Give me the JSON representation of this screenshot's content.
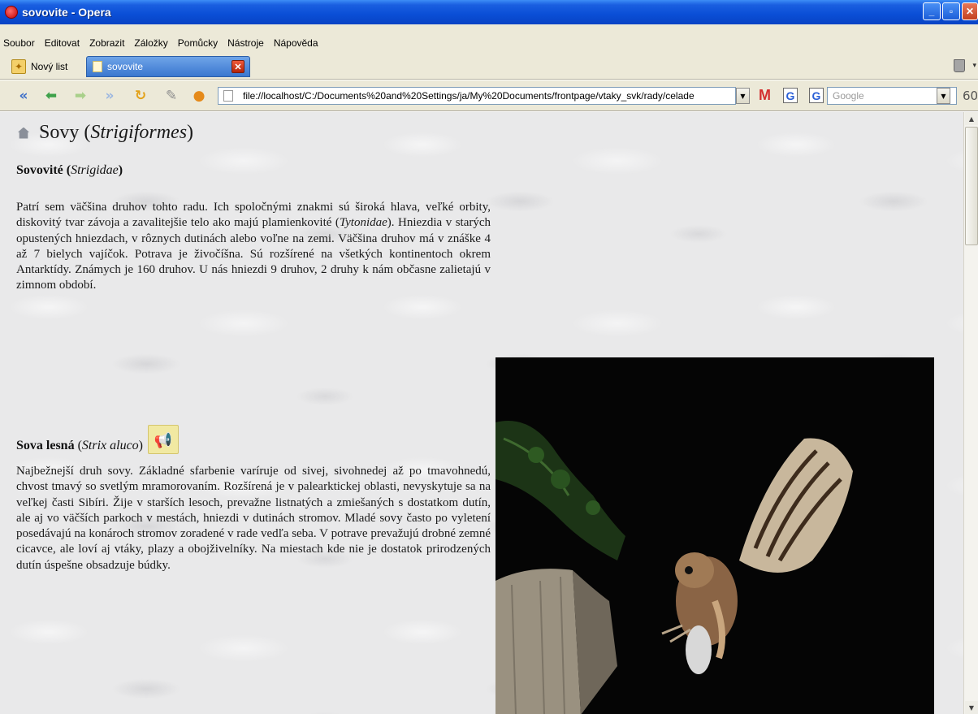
{
  "window": {
    "title": "sovovite - Opera",
    "minimize_label": "_",
    "maximize_label": "▫",
    "close_label": "✕"
  },
  "menu": {
    "items": [
      "Soubor",
      "Editovat",
      "Zobrazit",
      "Záložky",
      "Pomůcky",
      "Nástroje",
      "Nápověda"
    ]
  },
  "tabs": {
    "new_tab_label": "Nový list",
    "active_tab_label": "sovovite",
    "close_label": "✕"
  },
  "toolbar": {
    "address": "file://localhost/C:/Documents%20and%20Settings/ja/My%20Documents/frontpage/vtaky_svk/rady/celade",
    "search_placeholder": "Google",
    "gmail_glyph": "M",
    "g_glyph": "G"
  },
  "page": {
    "order_name": "Sovy",
    "order_latin": "Strigiformes",
    "family_name": "Sovovité",
    "family_latin": "Strigidae",
    "family_text_1": "Patrí sem väčšina druhov tohto radu. Ich spoločnými znakmi sú široká hlava, veľké orbity, diskovitý tvar závoja a zavalitejšie telo ako majú plamienkovité (",
    "family_text_latin": "Tytonidae",
    "family_text_2": "). Hniezdia v starých opustených hniezdach, v rôznych dutinách alebo voľne na zemi. Väčšina druhov má v znáške 4 až 7 bielych vajíčok. Potrava je živočíšna. Sú rozšírené na všetkých kontinentoch okrem Antarktídy. Známych je 160 druhov. U nás hniezdi 9 druhov, 2 druhy k nám občasne zalietajú v zimnom období.",
    "species_name": "Sova lesná",
    "species_latin": "Strix aluco",
    "species_text": "Najbežnejší druh sovy. Základné sfarbenie varíruje od sivej, sivohnedej až po tmavohnedú, chvost tmavý so svetlým mramorovaním. Rozšírená je v palearktickej oblasti, nevyskytuje sa na veľkej časti Sibíri. Žije v starších lesoch, prevažne listnatých a zmiešaných s dostatkom dutín, ale aj vo väčších parkoch v mestách, hniezdi v dutinách stromov. Mladé sovy často po vyletení posedávajú na konároch stromov zoradené v rade vedľa seba. V potrave prevažujú drobné zemné cicavce, ale loví aj vtáky, plazy a obojživelníky. Na miestach kde nie je dostatok prirodzených dutín úspešne obsadzuje búdky."
  },
  "icons": {
    "home": "home-icon",
    "sound": "speaker-icon",
    "back": "back-arrow-icon",
    "forward": "forward-arrow-icon"
  }
}
